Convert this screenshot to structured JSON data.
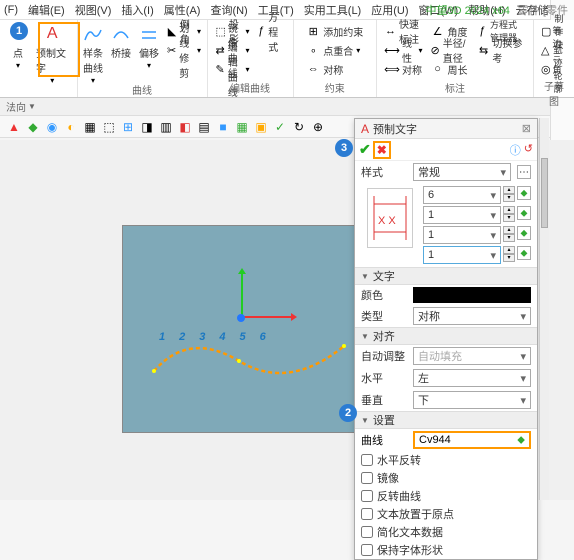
{
  "title_right": {
    "app": "中望3D 2024 x64",
    "doc": "零件 [零件"
  },
  "menu": [
    "(F)",
    "编辑(E)",
    "视图(V)",
    "插入(I)",
    "属性(A)",
    "查询(N)",
    "工具(T)",
    "实用工具(L)",
    "应用(U)",
    "窗口(W)",
    "帮助(H)",
    "云存储"
  ],
  "ribbon": {
    "g1": {
      "items": [
        {
          "t": "点"
        },
        {
          "t": "预制文字"
        }
      ],
      "label": ""
    },
    "g2": {
      "items": [
        {
          "t": "样条曲线"
        },
        {
          "t": "桥接"
        },
        {
          "t": "偏移"
        }
      ],
      "label": "曲线",
      "col": [
        {
          "t": "倒角"
        },
        {
          "t": "划线修剪"
        }
      ]
    },
    "g3": {
      "col1": [
        {
          "t": "投影"
        },
        {
          "t": "镜像曲线"
        },
        {
          "t": "编辑曲线"
        }
      ],
      "label": "编辑曲线",
      "col2": [
        {
          "t": "方程式"
        },
        {
          "t": ""
        },
        {
          "t": ""
        }
      ]
    },
    "g4": {
      "col": [
        {
          "t": "添加约束"
        },
        {
          "t": "点重合"
        },
        {
          "t": "对称"
        }
      ],
      "label": "约束",
      "col2": [
        {
          "t": ""
        },
        {
          "t": ""
        },
        {
          "t": ""
        }
      ]
    },
    "g5": {
      "col": [
        {
          "t": "快速标注"
        },
        {
          "t": "线性"
        },
        {
          "t": "对称"
        }
      ],
      "col2": [
        {
          "t": "角度"
        },
        {
          "t": "半径/直径"
        },
        {
          "t": "周长"
        }
      ],
      "col3": [
        {
          "t": "方程式管理器"
        },
        {
          "t": "切换参考"
        },
        {
          "t": ""
        }
      ],
      "label": "标注"
    },
    "g6": {
      "col": [
        {
          "t": "制作块"
        },
        {
          "t": "等边三角"
        },
        {
          "t": "轨迹轮廓"
        }
      ],
      "label": "子草图"
    }
  },
  "subbar": "法向",
  "panel": {
    "title": "预制文字",
    "style_label": "样式",
    "style_value": "常规",
    "spinners": [
      "6",
      "1",
      "1",
      "1"
    ],
    "sec_text": "文字",
    "color_label": "颜色",
    "type_label": "类型",
    "type_value": "对称",
    "sec_align": "对齐",
    "auto_label": "自动调整",
    "auto_value": "自动填充",
    "horiz_label": "水平",
    "horiz_value": "左",
    "vert_label": "垂直",
    "vert_value": "下",
    "sec_pos": "设置",
    "curve_label": "曲线",
    "curve_value": "Cv944",
    "checks": [
      "水平反转",
      "镜像",
      "反转曲线",
      "文本放置于原点",
      "简化文本数据",
      "保持字体形状"
    ]
  },
  "nums": [
    "1",
    "2",
    "3",
    "4",
    "5",
    "6"
  ],
  "circles": {
    "c1": "1",
    "c2": "2",
    "c3": "3"
  }
}
